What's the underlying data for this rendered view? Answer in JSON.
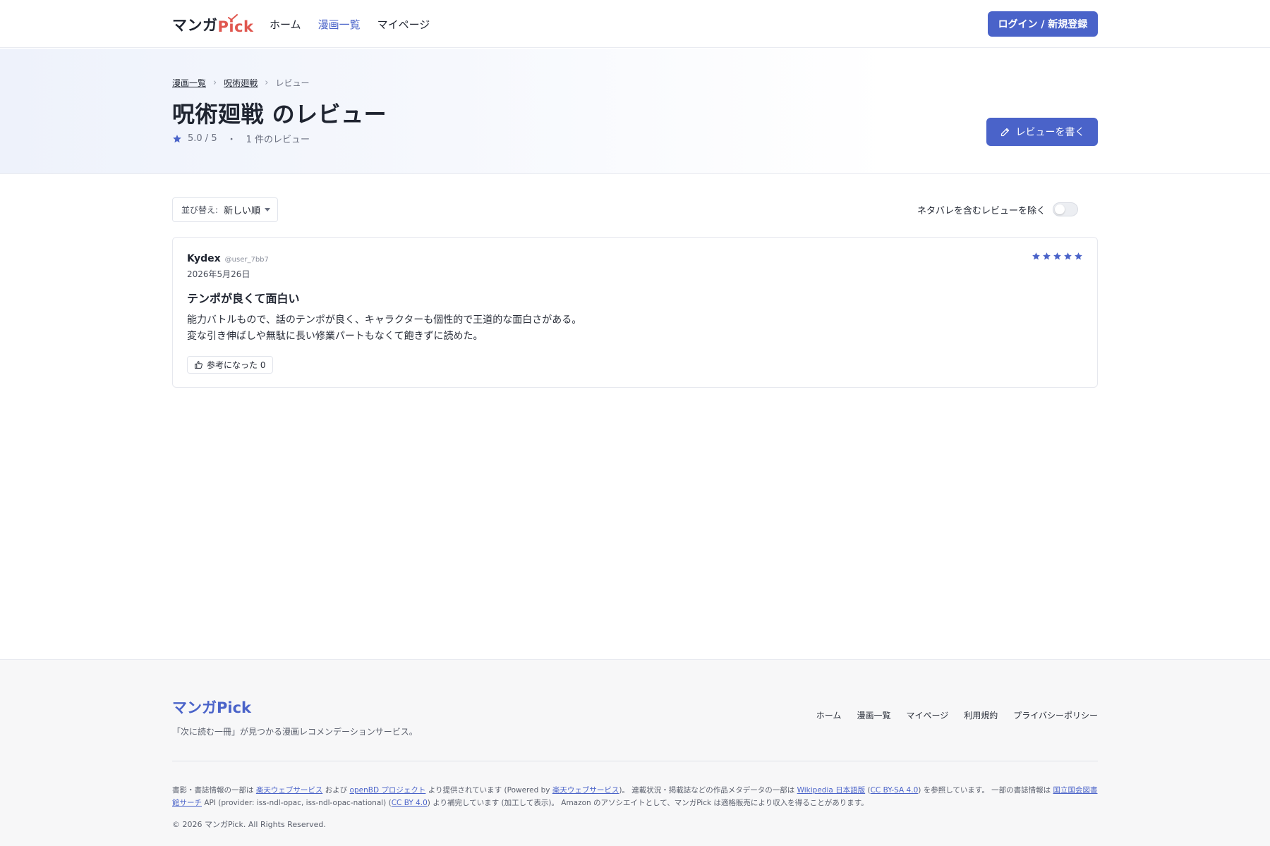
{
  "header": {
    "logo_manga": "マンガ",
    "logo_pick": "Pick",
    "nav": [
      {
        "label": "ホーム",
        "active": false
      },
      {
        "label": "漫画一覧",
        "active": true
      },
      {
        "label": "マイページ",
        "active": false
      }
    ],
    "login_label": "ログイン / 新規登録"
  },
  "hero": {
    "breadcrumb": [
      "漫画一覧",
      "呪術廻戦",
      "レビュー"
    ],
    "title": "呪術廻戦 のレビュー",
    "rating_text": "5.0 / 5",
    "separator": "・",
    "review_count_text": "1 件のレビュー",
    "write_label": "レビューを書く"
  },
  "controls": {
    "sort_label": "並び替え:",
    "sort_value": "新しい順",
    "spoiler_label": "ネタバレを含むレビューを除く",
    "spoiler_enabled": false
  },
  "review": {
    "name": "Kydex",
    "handle": "@user_7bb7",
    "date": "2026年5月26日",
    "rating": 5,
    "title": "テンポが良くて面白い",
    "body_lines": [
      "能力バトルもので、話のテンポが良く、キャラクターも個性的で王道的な面白さがある。",
      "変な引き伸ばしや無駄に長い修業パートもなくて飽きずに読めた。"
    ],
    "helpful_label": "参考になった 0"
  },
  "footer": {
    "logo": "マンガPick",
    "tagline": "「次に読む一冊」が見つかる漫画レコメンデーションサービス。",
    "nav": [
      "ホーム",
      "漫画一覧",
      "マイページ",
      "利用規約",
      "プライバシーポリシー"
    ],
    "credits": {
      "t1": "書影・書誌情報の一部は ",
      "l1": "楽天ウェブサービス",
      "t2": " および ",
      "l2": "openBD プロジェクト",
      "t3": " より提供されています (Powered by ",
      "l3": "楽天ウェブサービス",
      "t4": ")。 連載状況・掲載誌などの作品メタデータの一部は ",
      "l4": "Wikipedia 日本語版",
      "t5": " (",
      "l5": "CC BY-SA 4.0",
      "t6": ") を参照しています。 一部の書誌情報は ",
      "l6": "国立国会図書館サーチ",
      "t7": " API (provider: iss-ndl-opac, iss-ndl-opac-national) (",
      "l7": "CC BY 4.0",
      "t8": ") より補完しています (加工して表示)。 Amazon のアソシエイトとして、マンガPick は適格販売により収入を得ることがあります。"
    },
    "copyright": "© 2026 マンガPick. All Rights Reserved."
  },
  "colors": {
    "accent": "#4a63c9",
    "logo_pick": "#e0574f"
  }
}
